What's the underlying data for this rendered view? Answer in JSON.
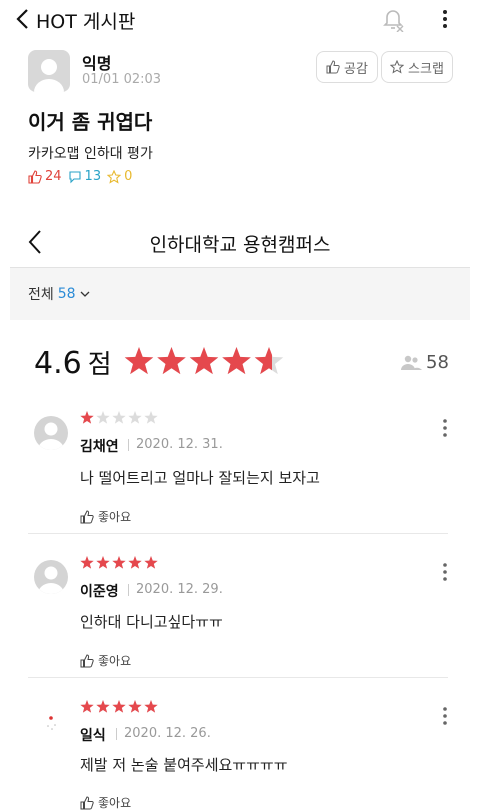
{
  "topbar": {
    "title": "HOT 게시판"
  },
  "post": {
    "author": "익명",
    "time": "01/01 02:03",
    "like_button": "공감",
    "scrap_button": "스크랩",
    "title": "이거 좀 귀엽다",
    "body": "카카오맵 인하대 평가",
    "likes": "24",
    "comments": "13",
    "scraps": "0"
  },
  "embed": {
    "title": "인하대학교 용현캠퍼스",
    "filter_label": "전체",
    "filter_count": "58",
    "score": "4.6",
    "score_unit": "점",
    "score_value": 4.6,
    "reviewer_count": "58"
  },
  "reviews": [
    {
      "name": "김채연",
      "date": "2020. 12. 31.",
      "text": "나 떨어트리고 얼마나 잘되는지 보자고",
      "rating": 1,
      "like_label": "좋아요"
    },
    {
      "name": "이준영",
      "date": "2020. 12. 29.",
      "text": "인하대 다니고싶다ㅠㅠ",
      "rating": 5,
      "like_label": "좋아요"
    },
    {
      "name": "일식",
      "date": "2020. 12. 26.",
      "text": "제발 저 논술 붙여주세요ㅠㅠㅠㅠ",
      "rating": 5,
      "like_label": "좋아요"
    }
  ],
  "colors": {
    "star_on": "#e5484d",
    "star_off": "#dcdcdc",
    "accent_blue": "#2b8bd6"
  }
}
